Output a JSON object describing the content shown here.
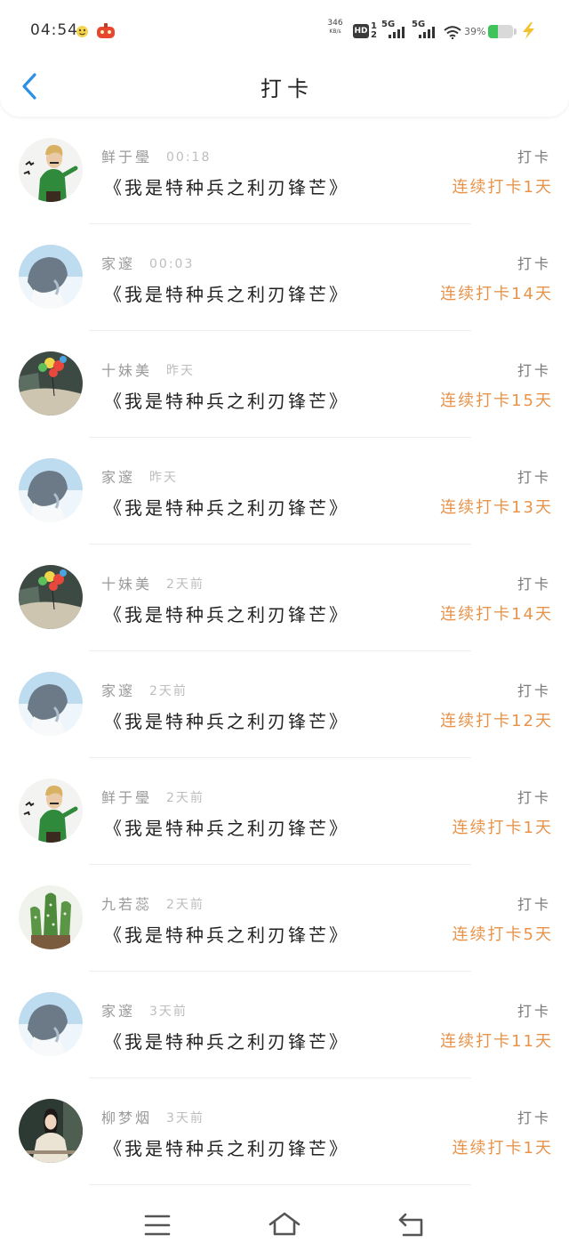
{
  "status_bar": {
    "time": "04:54",
    "net_speed": "346",
    "net_unit": "KB/s",
    "hd": "HD",
    "sim1": "1",
    "sim2": "2",
    "network1": "5G",
    "network2": "5G",
    "battery_text": "39%",
    "battery_level": 39,
    "icons": [
      "notification-icon",
      "notification-icon",
      "signal-icon",
      "signal-icon",
      "wifi-icon",
      "battery-icon",
      "charging-icon"
    ]
  },
  "header": {
    "title": "打卡",
    "back_icon": "back-arrow-icon"
  },
  "list": {
    "items": [
      {
        "name": "鲜于璺",
        "time": "00:18",
        "book": "《我是特种兵之利刃锋芒》",
        "action": "打卡",
        "streak": "连续打卡1天"
      },
      {
        "name": "家邃",
        "time": "00:03",
        "book": "《我是特种兵之利刃锋芒》",
        "action": "打卡",
        "streak": "连续打卡14天"
      },
      {
        "name": "十妹美",
        "time": "昨天",
        "book": "《我是特种兵之利刃锋芒》",
        "action": "打卡",
        "streak": "连续打卡15天"
      },
      {
        "name": "家邃",
        "time": "昨天",
        "book": "《我是特种兵之利刃锋芒》",
        "action": "打卡",
        "streak": "连续打卡13天"
      },
      {
        "name": "十妹美",
        "time": "2天前",
        "book": "《我是特种兵之利刃锋芒》",
        "action": "打卡",
        "streak": "连续打卡14天"
      },
      {
        "name": "家邃",
        "time": "2天前",
        "book": "《我是特种兵之利刃锋芒》",
        "action": "打卡",
        "streak": "连续打卡12天"
      },
      {
        "name": "鲜于璺",
        "time": "2天前",
        "book": "《我是特种兵之利刃锋芒》",
        "action": "打卡",
        "streak": "连续打卡1天"
      },
      {
        "name": "九若蕊",
        "time": "2天前",
        "book": "《我是特种兵之利刃锋芒》",
        "action": "打卡",
        "streak": "连续打卡5天"
      },
      {
        "name": "家邃",
        "time": "3天前",
        "book": "《我是特种兵之利刃锋芒》",
        "action": "打卡",
        "streak": "连续打卡11天"
      },
      {
        "name": "柳梦烟",
        "time": "3天前",
        "book": "《我是特种兵之利刃锋芒》",
        "action": "打卡",
        "streak": "连续打卡1天"
      }
    ]
  },
  "bottom_nav": {
    "icons": [
      "menu-icon",
      "home-icon",
      "back-icon"
    ]
  },
  "colors": {
    "accent": "#2b8fe6",
    "streak": "#e8934a",
    "battery": "#3ec45a",
    "charging": "#f2c230"
  }
}
